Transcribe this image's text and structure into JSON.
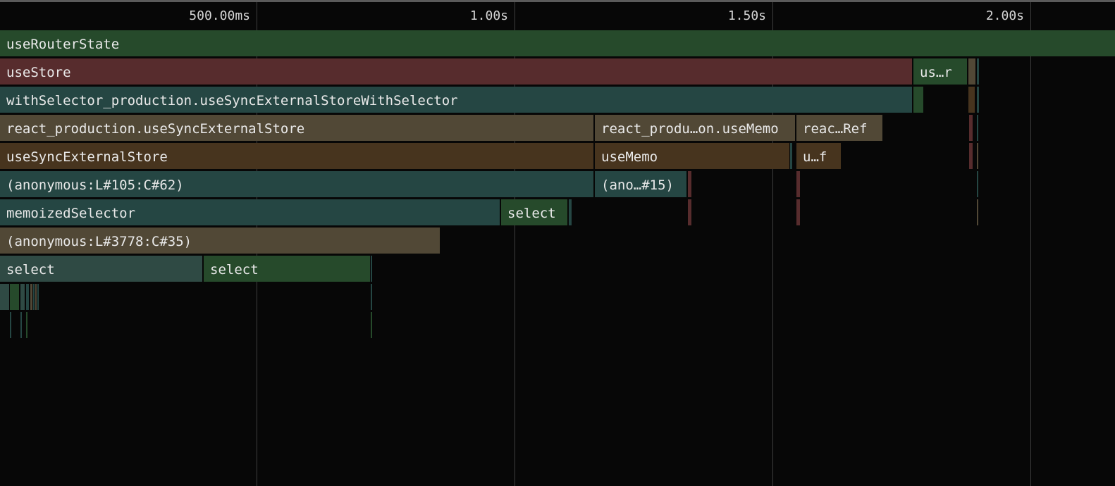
{
  "timeline": {
    "ticks": [
      "500.00ms",
      "1.00s",
      "1.50s",
      "2.00s"
    ]
  },
  "colors": {
    "background": "#070707",
    "gridline": "#3e3e3e",
    "text": "#e9e9e9",
    "green": "#264a2b",
    "red": "#572c2d",
    "teal": "#254643",
    "olive": "#514836",
    "brown": "#47341e"
  },
  "frames": {
    "row0": [
      "useRouterState"
    ],
    "row1": [
      "useStore",
      "us…r"
    ],
    "row2": [
      "withSelector_production.useSyncExternalStoreWithSelector"
    ],
    "row3": [
      "react_production.useSyncExternalStore",
      "react_produ…on.useMemo",
      "reac…Ref"
    ],
    "row4": [
      "useSyncExternalStore",
      "useMemo",
      "u…f"
    ],
    "row5": [
      "(anonymous:L#105:C#62)",
      "(ano…#15)"
    ],
    "row6": [
      "memoizedSelector",
      "select"
    ],
    "row7": [
      "(anonymous:L#3778:C#35)"
    ],
    "row8": [
      "select",
      "select"
    ]
  }
}
